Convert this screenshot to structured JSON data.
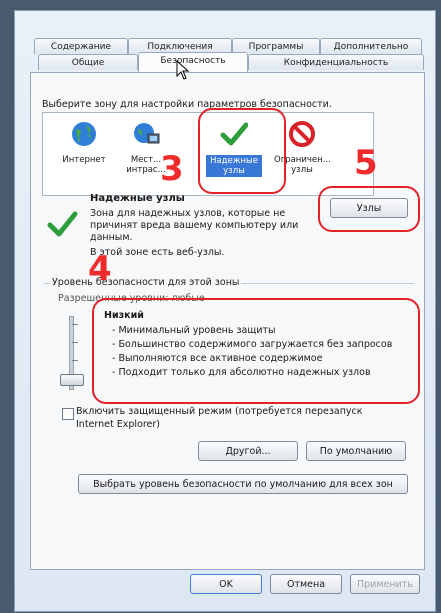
{
  "tabs_row1": [
    "Содержание",
    "Подключения",
    "Программы",
    "Дополнительно"
  ],
  "tabs_row2": [
    "Общие",
    "Безопасность",
    "Конфиденциальность"
  ],
  "instruction": "Выберите зону для настройки параметров безопасности.",
  "zones": [
    {
      "label": "Интернет",
      "icon": "globe-icon"
    },
    {
      "label": "Мест... интрас...",
      "icon": "local-intranet-icon"
    },
    {
      "label": "Надежные узлы",
      "icon": "check-icon"
    },
    {
      "label": "Ограничен... узлы",
      "icon": "restricted-icon"
    }
  ],
  "zone_title": "Надежные узлы",
  "zone_desc": [
    "Зона для надежных узлов, которые не",
    "причинят вреда вашему компьютеру или",
    "данным.",
    "В этой зоне есть веб-узлы."
  ],
  "sites_button": "Узлы",
  "security_level_group": "Уровень безопасности для этой зоны",
  "allowed_levels": "Разрешенные уровни: любые",
  "level_name": "Низкий",
  "level_points": [
    "- Минимальный уровень защиты",
    "- Большинство содержимого загружается без запросов",
    "- Выполняются все активное содержимое",
    "- Подходит только для абсолютно надежных узлов"
  ],
  "slider_level": 0,
  "protected_mode_label": [
    "Включить защищенный режим (потребуется перезапуск",
    "Internet Explorer)"
  ],
  "custom_button": "Другой...",
  "default_button": "По умолчанию",
  "reset_all_button": "Выбрать уровень безопасности по умолчанию для всех зон",
  "ok_button": "OK",
  "cancel_button": "Отмена",
  "apply_button": "Применить",
  "annotations": [
    "3",
    "4",
    "5"
  ],
  "colors": {
    "accent": "#3a78d8",
    "annotation": "#e2232a"
  }
}
